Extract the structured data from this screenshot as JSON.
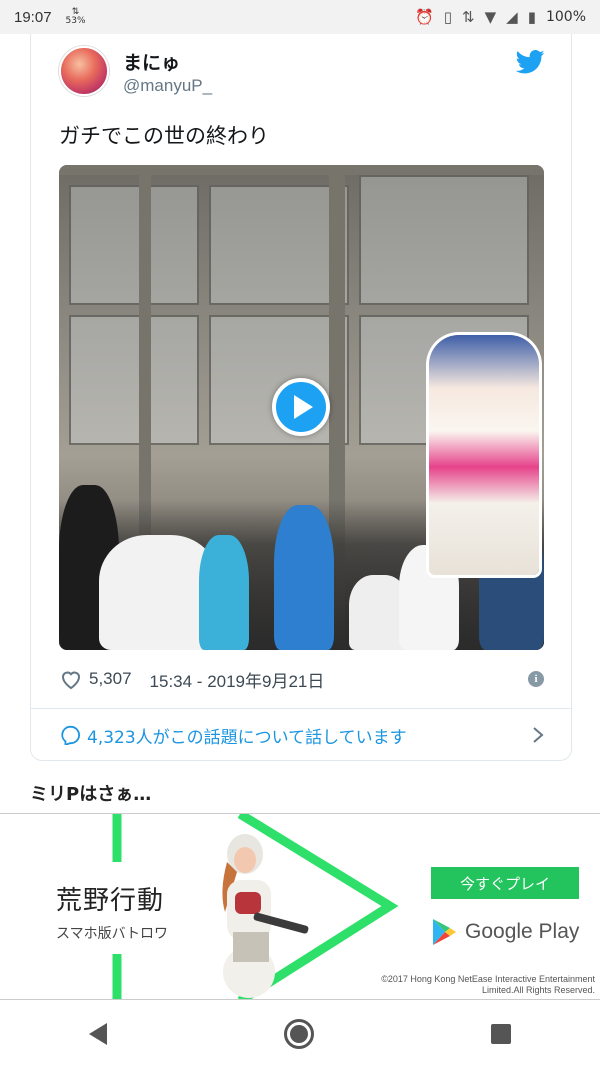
{
  "status_bar": {
    "time": "19:07",
    "data_rate": "53%",
    "battery_percent": "100%",
    "icons": [
      "alarm-icon",
      "vibrate-icon",
      "data-arrows-icon",
      "wifi-icon",
      "cell-signal-icon",
      "battery-icon"
    ]
  },
  "tweet": {
    "display_name": "まにゅ",
    "handle": "@manyuP_",
    "text": "ガチでこの世の終わり",
    "likes": "5,307",
    "datetime": "15:34 - 2019年9月21日",
    "conversation": "4,323人がこの話題について話しています",
    "accent_color": "#1da1f2",
    "icons": [
      "twitter-bird-icon",
      "play-icon",
      "heart-icon",
      "info-icon",
      "reply-bubble-icon",
      "chevron-right-icon"
    ]
  },
  "section_title": "ミリPはさぁ…",
  "ad": {
    "title": "荒野行動",
    "subtitle": "スマホ版バトロワ",
    "cta": "今すぐプレイ",
    "store": "Google Play",
    "legal_line1": "©2017 Hong Kong NetEase Interactive Entertainment",
    "legal_line2": "Limited.All Rights Reserved.",
    "accent_color": "#23c45e"
  },
  "nav_bar": {
    "icons": [
      "back-icon",
      "home-icon",
      "recents-icon"
    ]
  }
}
